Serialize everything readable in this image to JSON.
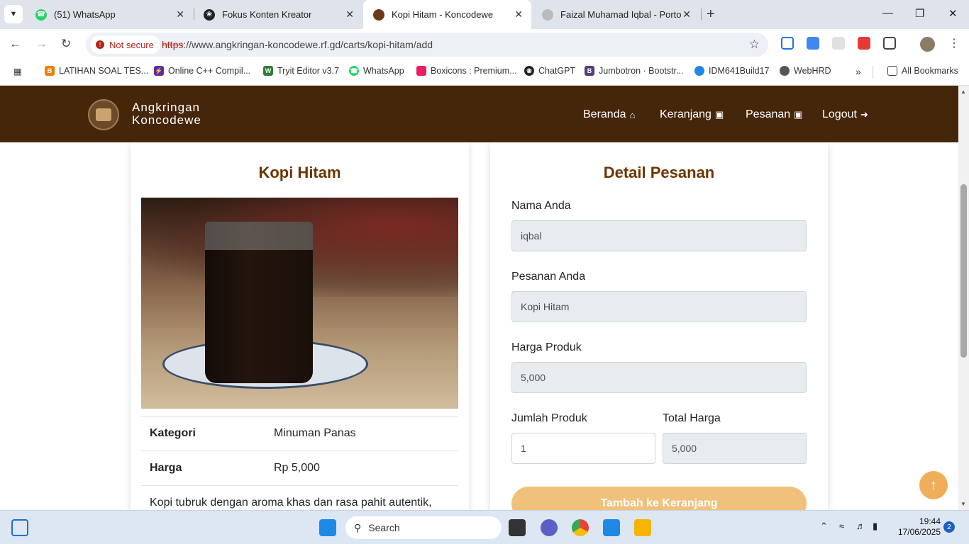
{
  "browser": {
    "tabs": [
      {
        "title": "(51) WhatsApp",
        "icon": "whatsapp-icon",
        "color": "#25d366"
      },
      {
        "title": "Fokus Konten Kreator",
        "icon": "openai-icon",
        "color": "#222222"
      },
      {
        "title": "Kopi Hitam - Koncodewe",
        "icon": "site-icon",
        "color": "#6b3a1a"
      },
      {
        "title": "Faizal Muhamad Iqbal - Portofo",
        "icon": "globe-icon",
        "color": "#999999"
      }
    ],
    "security_label": "Not secure",
    "url_protocol": "https",
    "url_rest": "://www.angkringan-koncodewe.rf.gd/carts/kopi-hitam/add",
    "bookmarks": [
      {
        "label": "LATIHAN SOAL TES...",
        "color": "#f57c00",
        "icon": "blogger-icon"
      },
      {
        "label": "Online C++ Compil...",
        "color": "#5b2ea6",
        "icon": "bolt-icon"
      },
      {
        "label": "Tryit Editor v3.7",
        "color": "#2e7d32",
        "icon": "w3-icon"
      },
      {
        "label": "WhatsApp",
        "color": "#25d366",
        "icon": "whatsapp-icon"
      },
      {
        "label": "Boxicons : Premium...",
        "color": "#e91e63",
        "icon": "boxicons-icon"
      },
      {
        "label": "ChatGPT",
        "color": "#222222",
        "icon": "openai-icon"
      },
      {
        "label": "Jumbotron · Bootstr...",
        "color": "#563d7c",
        "icon": "bootstrap-icon"
      },
      {
        "label": "IDM641Build17",
        "color": "#1e88e5",
        "icon": "idm-icon"
      },
      {
        "label": "WebHRD",
        "color": "#555555",
        "icon": "globe-icon"
      }
    ],
    "all_bookmarks": "All Bookmarks"
  },
  "site": {
    "brand_line1": "Angkringan",
    "brand_line2": "Koncodewe",
    "nav": [
      {
        "label": "Beranda",
        "icon": "home-icon"
      },
      {
        "label": "Keranjang",
        "icon": "bag-icon"
      },
      {
        "label": "Pesanan",
        "icon": "bag-icon"
      },
      {
        "label": "Logout",
        "icon": "logout-icon"
      }
    ]
  },
  "product": {
    "title": "Kopi Hitam",
    "rows": [
      {
        "key": "Kategori",
        "value": "Minuman Panas"
      },
      {
        "key": "Harga",
        "value": "Rp 5,000"
      }
    ],
    "description": "Kopi tubruk dengan aroma khas dan rasa pahit autentik,"
  },
  "order": {
    "title": "Detail Pesanan",
    "name_label": "Nama Anda",
    "name_value": "iqbal",
    "order_label": "Pesanan Anda",
    "order_value": "Kopi Hitam",
    "price_label": "Harga Produk",
    "price_value": "5,000",
    "qty_label": "Jumlah Produk",
    "qty_value": "1",
    "total_label": "Total Harga",
    "total_value": "5,000",
    "submit_label": "Tambah ke Keranjang"
  },
  "taskbar": {
    "search_label": "Search",
    "time": "19:44",
    "date": "17/06/2025",
    "notification_count": "2"
  },
  "colors": {
    "navbar": "#46260a",
    "heading": "#6b3500",
    "button": "#f0c17a",
    "scroll_top": "#f0ae5b"
  }
}
